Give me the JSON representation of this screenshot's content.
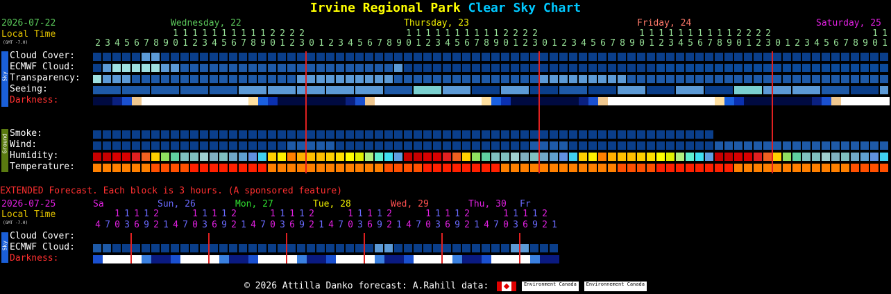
{
  "title": {
    "site": "Irvine Regional Park",
    "chart": "Clear Sky Chart"
  },
  "colors": {
    "accent": "#ffff00",
    "chart_name": "#00c8ff",
    "darkness_label": "#ff3030",
    "midnight_line": "#e02020"
  },
  "main": {
    "date": "2026-07-22",
    "local_time": "Local Time",
    "gmt": "(GMT -7.0)",
    "days": [
      {
        "label": "Wednesday, 22",
        "color": "#5ac85a"
      },
      {
        "label": "Thursday, 23",
        "color": "#f0f000"
      },
      {
        "label": "Friday, 24",
        "color": "#ff7a6a"
      },
      {
        "label": "Saturday, 25",
        "color": "#e020e0"
      }
    ],
    "hour_color": "#96e096",
    "sky_rows": [
      "Cloud Cover:",
      "ECMWF Cloud:",
      "Transparency:",
      "Seeing:",
      "Darkness:"
    ],
    "ground_rows": [
      "Smoke:",
      "Wind:",
      "Humidity:",
      "Temperature:"
    ],
    "sky_tab": "Sky",
    "ground_tab": "Ground"
  },
  "extended": {
    "header": "EXTENDED Forecast. Each block is 3 hours. (A sponsored feature)",
    "date": "2026-07-25",
    "local_time": "Local Time",
    "gmt": "(GMT -7.0)",
    "days": [
      {
        "label": "Sa",
        "color": "#e020e0"
      },
      {
        "label": "Sun, 26",
        "color": "#6a6aff"
      },
      {
        "label": "Mon, 27",
        "color": "#30e030"
      },
      {
        "label": "Tue, 28",
        "color": "#f0f000"
      },
      {
        "label": "Wed, 29",
        "color": "#ff5050"
      },
      {
        "label": "Thu, 30",
        "color": "#e020e0"
      },
      {
        "label": "Fr",
        "color": "#6a6aff"
      }
    ],
    "rows": [
      "Cloud Cover:",
      "ECMWF Cloud:",
      "Darkness:"
    ],
    "sky_tab": "Sky"
  },
  "footer": {
    "text": "© 2026 Attilla Danko  forecast: A.Rahill  data:",
    "env1": "Environment Canada",
    "env2": "Environnement Canada"
  }
}
